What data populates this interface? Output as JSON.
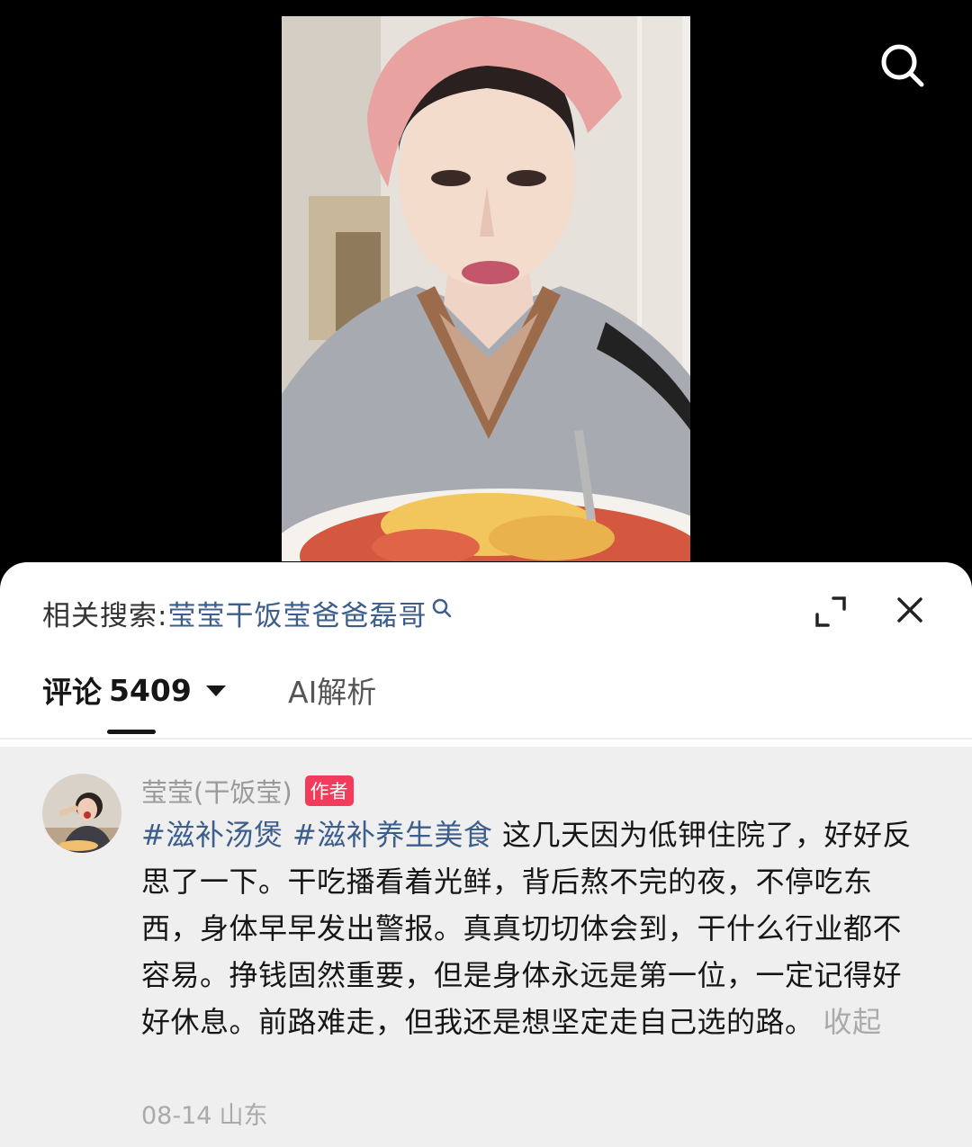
{
  "related_search": {
    "label": "相关搜索:",
    "query": "莹莹干饭莹爸爸磊哥"
  },
  "tabs": {
    "comments_label": "评论",
    "comments_count": "5409",
    "ai_label": "AI解析"
  },
  "comment": {
    "author": "莹莹(干饭莹)",
    "badge": "作者",
    "hashtags": [
      "#滋补汤煲",
      "#滋补养生美食"
    ],
    "text": "这几天因为低钾住院了，好好反思了一下。干吃播看着光鲜，背后熬不完的夜，不停吃东西，身体早早发出警报。真真切切体会到，干什么行业都不容易。挣钱固然重要，但是身体永远是第一位，一定记得好好休息。前路难走，但我还是想坚定走自己选的路。",
    "collapse_label": "收起",
    "date": "08-14",
    "location": "山东"
  },
  "colors": {
    "link_blue": "#3c5e8c",
    "badge_red": "#f33b5b",
    "comment_bg": "#efefef"
  },
  "icons": [
    "search-icon",
    "expand-icon",
    "close-icon",
    "dropdown-caret-icon"
  ]
}
